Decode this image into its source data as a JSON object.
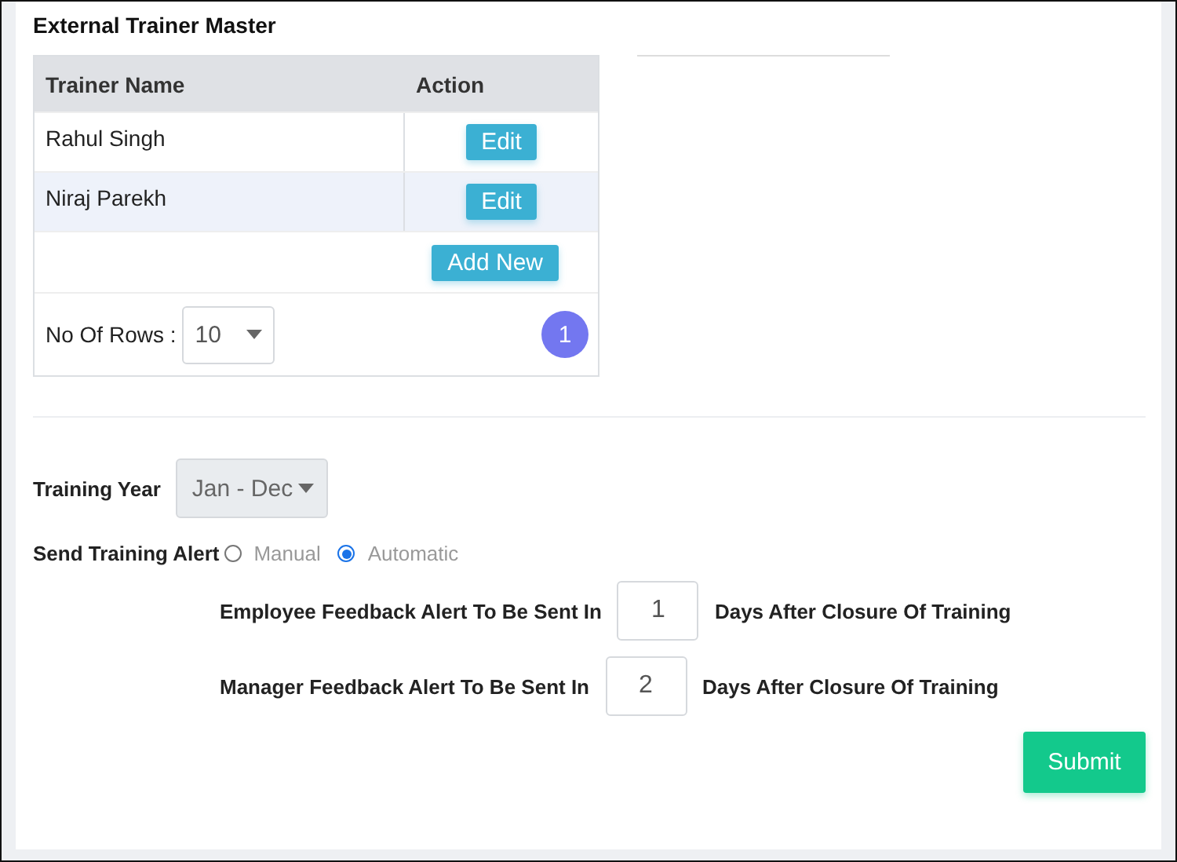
{
  "title": "External Trainer Master",
  "table": {
    "columns": [
      "Trainer Name",
      "Action"
    ],
    "rows": [
      {
        "name": "Rahul Singh",
        "action": "Edit"
      },
      {
        "name": "Niraj Parekh",
        "action": "Edit"
      }
    ],
    "add_button": "Add New",
    "rows_label": "No Of Rows :",
    "rows_select": "10",
    "pages": [
      {
        "label": "1",
        "selected": true
      }
    ]
  },
  "settings": {
    "training_year": {
      "label": "Training Year",
      "value": "Jan - Dec",
      "disabled": true
    },
    "alert": {
      "label": "Send Training Alert",
      "options": [
        {
          "label": "Manual",
          "selected": false
        },
        {
          "label": "Automatic",
          "selected": true
        }
      ]
    },
    "feedback": [
      {
        "label": "Employee Feedback Alert To Be Sent In",
        "value": "1",
        "suffix": "Days After Closure Of Training"
      },
      {
        "label": "Manager Feedback Alert To Be Sent In",
        "value": "2",
        "suffix": "Days After Closure Of Training"
      }
    ],
    "submit": "Submit"
  }
}
